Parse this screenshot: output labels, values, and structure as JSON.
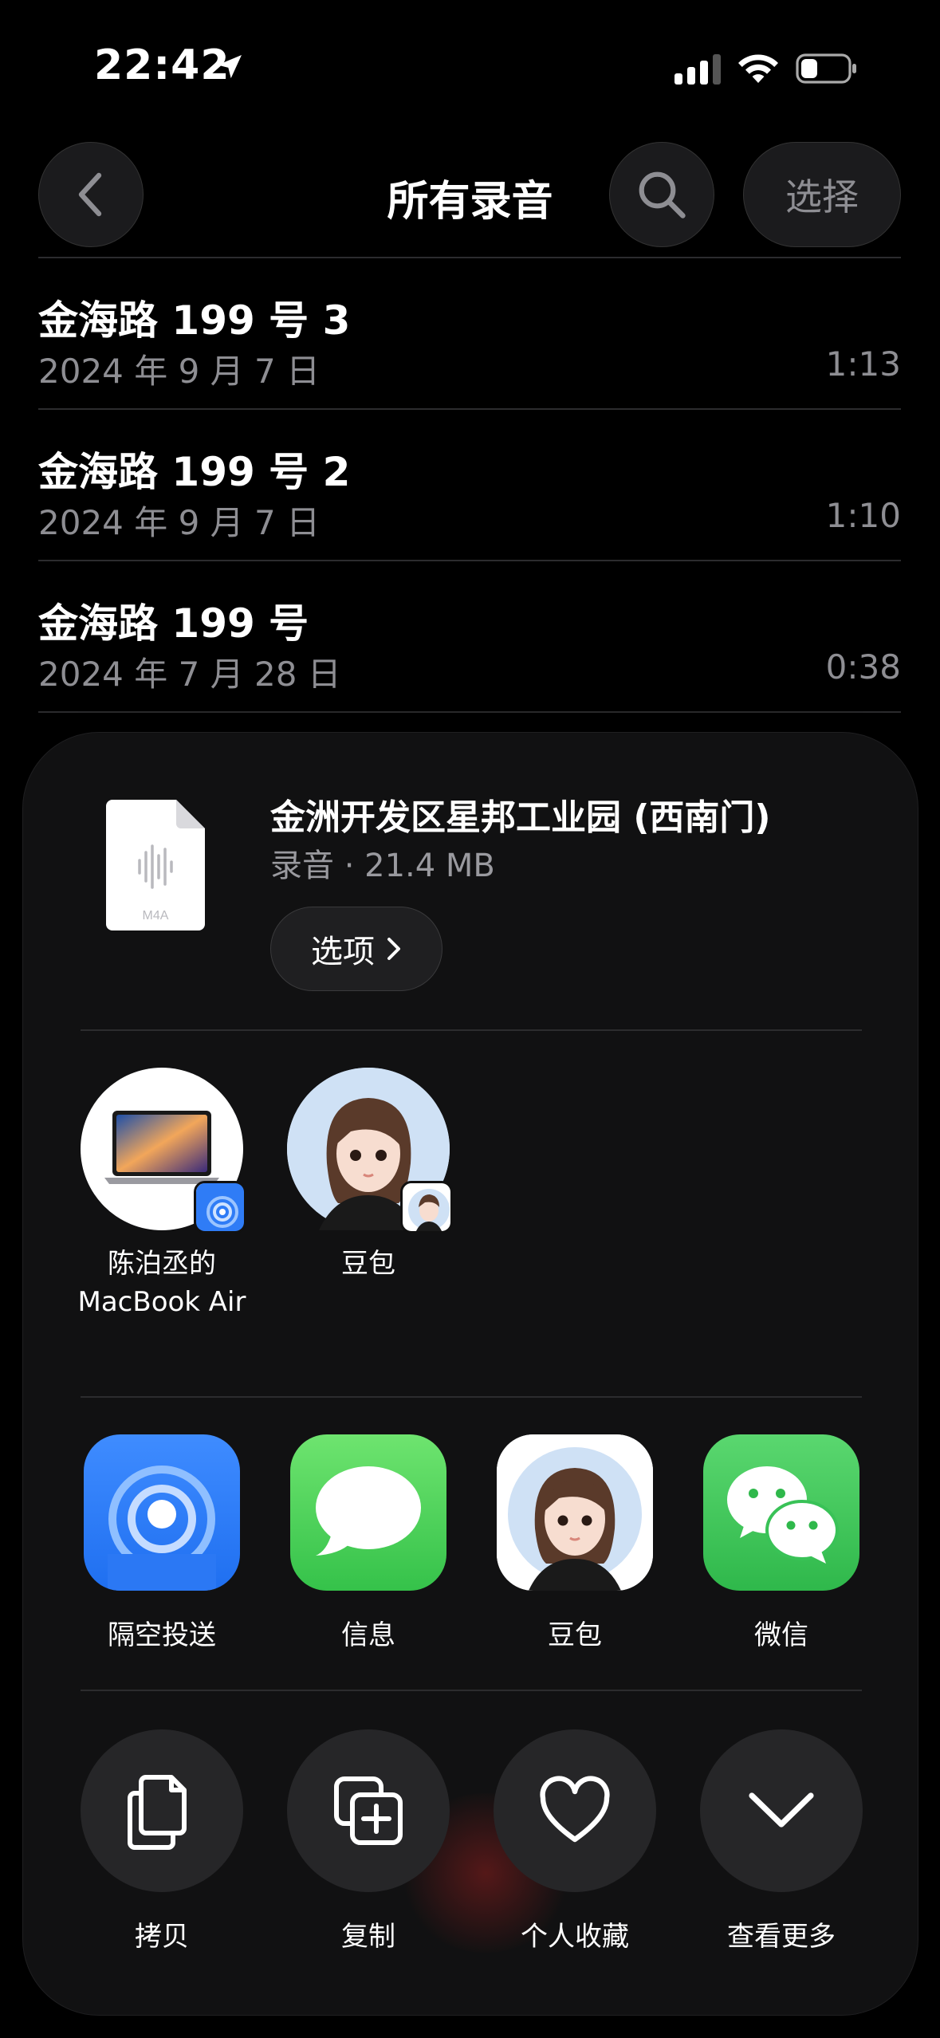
{
  "status": {
    "time": "22:42"
  },
  "nav": {
    "title": "所有录音",
    "select_label": "选择"
  },
  "recordings": [
    {
      "title": "金海路 199 号 3",
      "date": "2024 年 9 月 7 日",
      "duration": "1:13"
    },
    {
      "title": "金海路 199 号 2",
      "date": "2024 年 9 月 7 日",
      "duration": "1:10"
    },
    {
      "title": "金海路 199 号",
      "date": "2024 年 7 月 28 日",
      "duration": "0:38"
    }
  ],
  "share_sheet": {
    "file_type_label": "M4A",
    "file_title": "金洲开发区星邦工业园 (西南门)",
    "file_subtitle": "录音 · 21.4 MB",
    "options_label": "选项",
    "people": [
      {
        "name_line1": "陈泊丞的",
        "name_line2": "MacBook Air",
        "icon": "macbook-icon",
        "badge": "airdrop-icon"
      },
      {
        "name_line1": "豆包",
        "name_line2": "",
        "icon": "doubao-avatar",
        "badge": "doubao-icon"
      }
    ],
    "apps": [
      {
        "name": "隔空投送",
        "icon": "airdrop-icon"
      },
      {
        "name": "信息",
        "icon": "messages-icon"
      },
      {
        "name": "豆包",
        "icon": "doubao-icon"
      },
      {
        "name": "微信",
        "icon": "wechat-icon"
      }
    ],
    "actions": [
      {
        "name": "拷贝",
        "icon": "copy-icon"
      },
      {
        "name": "复制",
        "icon": "duplicate-icon"
      },
      {
        "name": "个人收藏",
        "icon": "heart-icon"
      },
      {
        "name": "查看更多",
        "icon": "chevron-down-icon"
      }
    ]
  },
  "colors": {
    "background": "#000000",
    "secondary_text": "#8e8e93",
    "sheet_background": "#111112",
    "airdrop_blue": "#2f7cf6",
    "messages_green": "#4cd964",
    "wechat_green": "#3fc35a"
  }
}
